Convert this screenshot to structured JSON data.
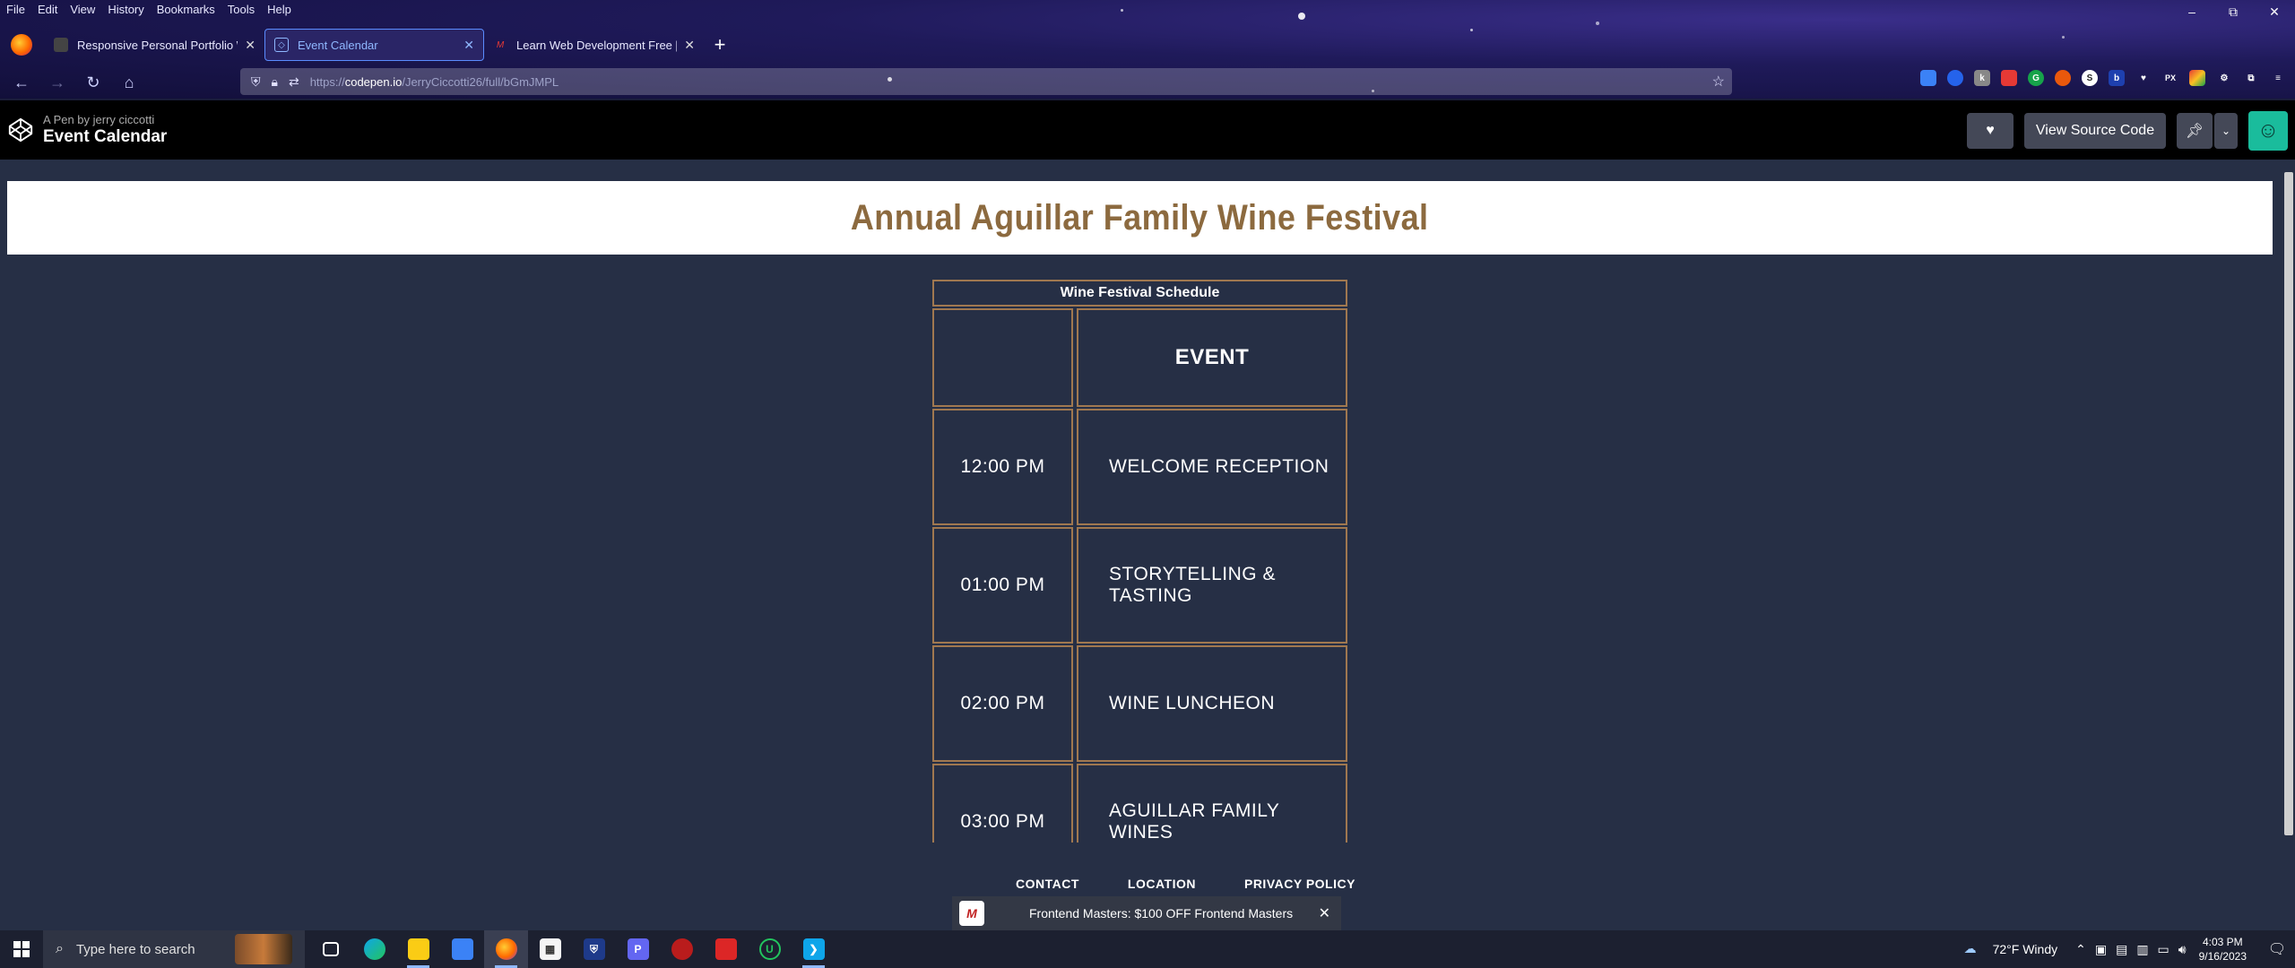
{
  "browser": {
    "menu": [
      "File",
      "Edit",
      "View",
      "History",
      "Bookmarks",
      "Tools",
      "Help"
    ],
    "tabs": [
      {
        "title": "Responsive Personal Portfolio Webs",
        "active": false
      },
      {
        "title": "Event Calendar",
        "active": true
      },
      {
        "title": "Learn Web Development Free [C",
        "active": false
      }
    ],
    "url": {
      "prefix": "https://",
      "host": "codepen.io",
      "path": "/JerryCiccotti26/full/bGmJMPL"
    }
  },
  "codepen": {
    "subtitle": "A Pen by jerry ciccotti",
    "title": "Event Calendar",
    "view_source_label": "View Source Code"
  },
  "page": {
    "heading": "Annual Aguillar Family Wine Festival",
    "schedule": {
      "caption": "Wine Festival Schedule",
      "header_time": "",
      "header_event": "EVENT",
      "rows": [
        {
          "time": "12:00 PM",
          "event": "WELCOME RECEPTION"
        },
        {
          "time": "01:00 PM",
          "event": "STORYTELLING & TASTING"
        },
        {
          "time": "02:00 PM",
          "event": "WINE LUNCHEON"
        },
        {
          "time": "03:00 PM",
          "event": "AGUILLAR FAMILY WINES"
        }
      ]
    },
    "footer_links": [
      "CONTACT",
      "LOCATION",
      "PRIVACY POLICY"
    ],
    "ad": {
      "text": "Frontend Masters: $100 OFF Frontend Masters"
    }
  },
  "taskbar": {
    "search_placeholder": "Type here to search",
    "weather": "72°F  Windy",
    "time": "4:03 PM",
    "date": "9/16/2023"
  },
  "colors": {
    "accent_border": "#a07850",
    "heading": "#8c6a3f",
    "page_bg": "#262f45"
  }
}
